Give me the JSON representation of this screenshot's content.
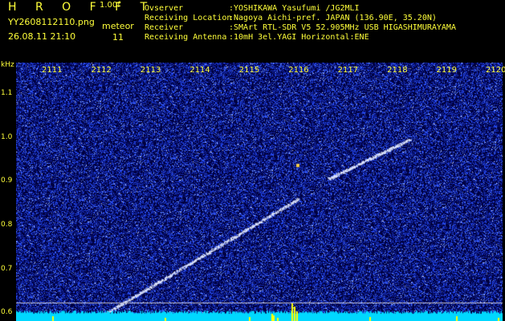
{
  "header": {
    "brand": "H R O F F T",
    "version": "1.00f",
    "filename": "YY2608112110.png",
    "datetime": "26.08.11 21:10",
    "kind": "meteor",
    "count": "11"
  },
  "info": [
    {
      "label": "Ovserver",
      "value": ":YOSHIKAWA Yasufumi /JG2MLI"
    },
    {
      "label": "Receiving Location",
      "value": ":Nagoya Aichi-pref. JAPAN (136.90E, 35.20N)"
    },
    {
      "label": "Receiver",
      "value": ":SMArt RTL-SDR V5 52.905MHz USB HIGASHIMURAYAMA"
    },
    {
      "label": "Receiving Antenna",
      "value": ":10mH 3el.YAGI Horizontal:ENE"
    }
  ],
  "chart_data": {
    "type": "heatmap",
    "ylabel": "kHz",
    "y_ticks": [
      {
        "label": "1.1",
        "value": 1.1
      },
      {
        "label": "1.0",
        "value": 1.0
      },
      {
        "label": "0.9",
        "value": 0.9
      },
      {
        "label": "0.8",
        "value": 0.8
      },
      {
        "label": "0.7",
        "value": 0.7
      },
      {
        "label": "0.6",
        "value": 0.6
      }
    ],
    "x_ticks": [
      "2111",
      "2112",
      "2113",
      "2114",
      "2115",
      "2116",
      "2117",
      "2118",
      "2119",
      "2120"
    ],
    "x_range": [
      2111,
      2120
    ],
    "y_range": [
      0.58,
      1.17
    ],
    "colors": {
      "background": "#000040",
      "noise": "#3050ff",
      "signal": "#ffffff",
      "baseline": "#00d8ff",
      "spike": "#ffff00"
    }
  }
}
